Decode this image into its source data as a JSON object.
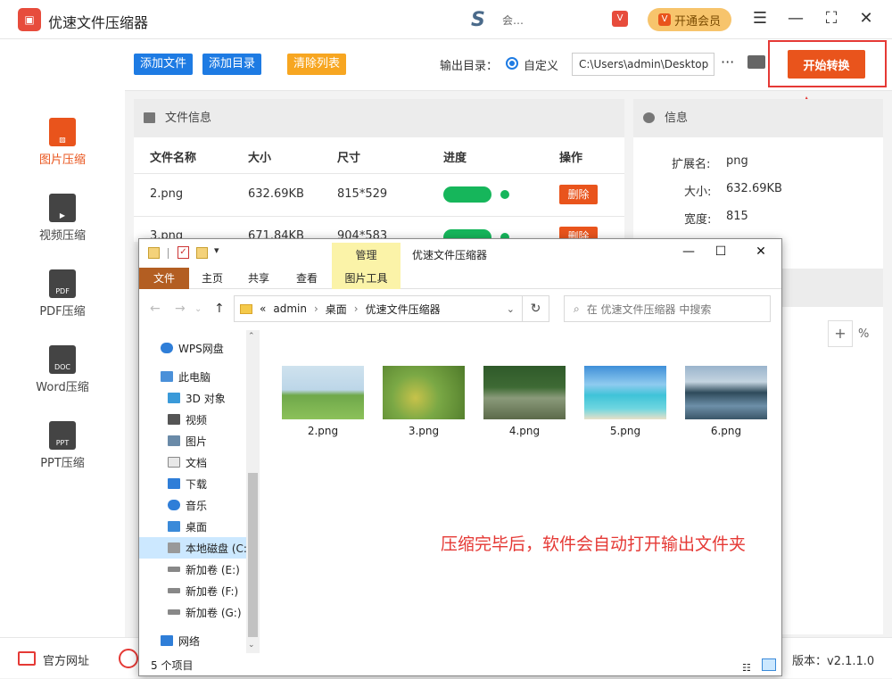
{
  "app": {
    "title": "优速文件压缩器",
    "user_name": "会…",
    "vip_label": "开通会员",
    "version": "版本：v2.1.1.0"
  },
  "sidebar": {
    "items": [
      {
        "label": "图片压缩",
        "icon": "image-file-icon",
        "active": true
      },
      {
        "label": "视频压缩",
        "icon": "video-file-icon"
      },
      {
        "label": "PDF压缩",
        "icon": "pdf-file-icon",
        "tag": "PDF"
      },
      {
        "label": "Word压缩",
        "icon": "doc-file-icon",
        "tag": "DOC"
      },
      {
        "label": "PPT压缩",
        "icon": "ppt-file-icon",
        "tag": "PPT"
      }
    ]
  },
  "toolbar": {
    "add_file": "添加文件",
    "add_dir": "添加目录",
    "clear_list": "清除列表",
    "output_label": "输出目录：",
    "custom_label": "自定义",
    "output_path": "C:\\Users\\admin\\Desktop",
    "start": "开始转换"
  },
  "files": {
    "title": "文件信息",
    "columns": [
      "文件名称",
      "大小",
      "尺寸",
      "进度",
      "操作"
    ],
    "rows": [
      {
        "name": "2.png",
        "size": "632.69KB",
        "dims": "815*529",
        "delete": "删除"
      },
      {
        "name": "3.png",
        "size": "671.84KB",
        "dims": "904*583",
        "delete": "删除"
      }
    ]
  },
  "info": {
    "title": "信息",
    "ext_label": "扩展名:",
    "ext_value": "png",
    "size_label": "大小:",
    "size_value": "632.69KB",
    "width_label": "宽度:",
    "width_value": "815",
    "plus": "+",
    "percent": "%"
  },
  "bottom": {
    "website": "官方网址"
  },
  "explorer": {
    "manage_tab": "管理",
    "window_title": "优速文件压缩器",
    "ribbon": [
      "文件",
      "主页",
      "共享",
      "查看",
      "图片工具"
    ],
    "breadcrumb": [
      "admin",
      "桌面",
      "优速文件压缩器"
    ],
    "breadcrumb_prefix": "«",
    "search_placeholder": "在 优速文件压缩器 中搜索",
    "nav": [
      {
        "label": "WPS网盘",
        "color": "#2f7ed8"
      },
      {
        "label": "此电脑",
        "color": "#4a90d9"
      },
      {
        "label": "3D 对象",
        "color": "#3a9ad9"
      },
      {
        "label": "视频",
        "color": "#555"
      },
      {
        "label": "图片",
        "color": "#6a8aa8"
      },
      {
        "label": "文档",
        "color": "#7a8a9a"
      },
      {
        "label": "下载",
        "color": "#2f7ed8"
      },
      {
        "label": "音乐",
        "color": "#2f7ed8"
      },
      {
        "label": "桌面",
        "color": "#3a8ad9"
      },
      {
        "label": "本地磁盘 (C:",
        "color": "#888"
      },
      {
        "label": "新加卷 (E:)",
        "color": "#888"
      },
      {
        "label": "新加卷 (F:)",
        "color": "#888"
      },
      {
        "label": "新加卷 (G:)",
        "color": "#888"
      },
      {
        "label": "网络",
        "color": "#2f7ed8"
      }
    ],
    "files": [
      {
        "name": "2.png",
        "colors": [
          "#bcd6e8",
          "#6fa84a",
          "#8cc15a"
        ]
      },
      {
        "name": "3.png",
        "colors": [
          "#7aa845",
          "#c7c24a",
          "#4f7a2a"
        ]
      },
      {
        "name": "4.png",
        "colors": [
          "#2f5a2a",
          "#8a9a7a",
          "#5c6a4a"
        ]
      },
      {
        "name": "5.png",
        "colors": [
          "#6db7e8",
          "#3fc3d8",
          "#e8e0c8"
        ]
      },
      {
        "name": "6.png",
        "colors": [
          "#9ab4cc",
          "#2e4a5a",
          "#6d8fa8"
        ]
      }
    ],
    "annotation": "压缩完毕后，软件会自动打开输出文件夹",
    "status": "5 个项目"
  }
}
